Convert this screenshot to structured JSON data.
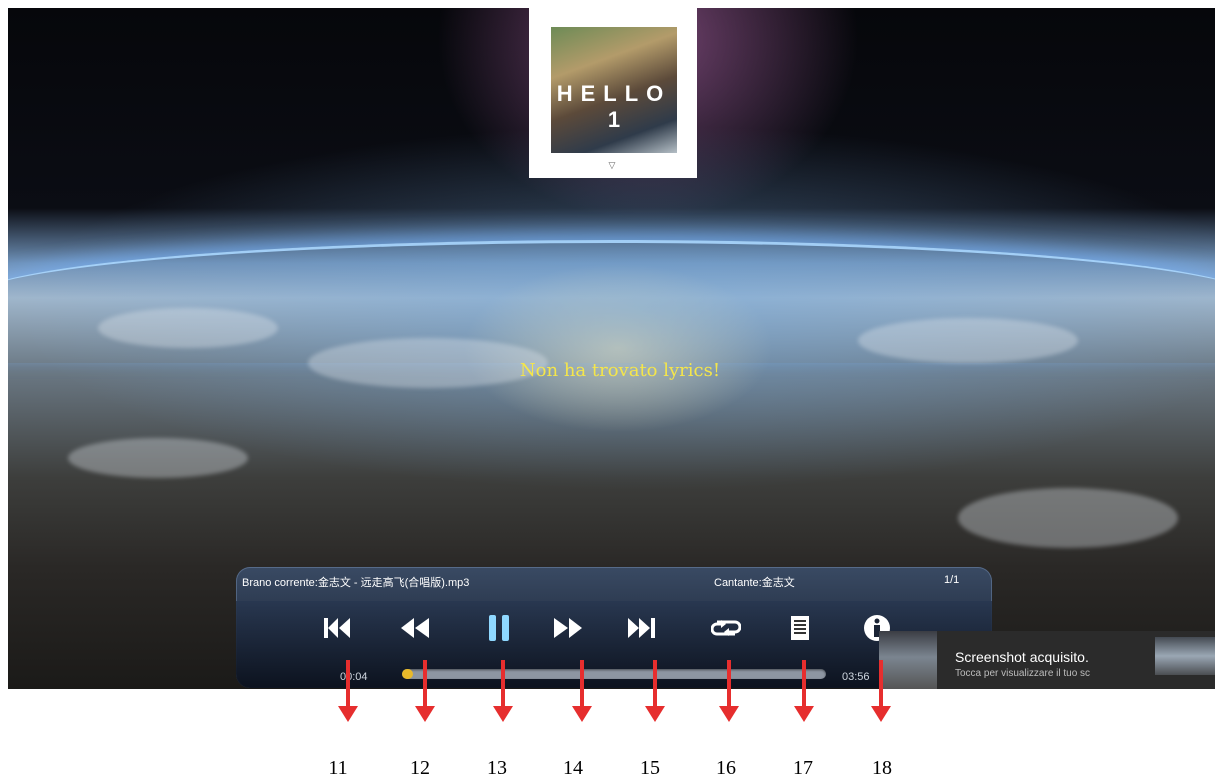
{
  "album": {
    "title": "HELLO",
    "number": "1",
    "logo": "▽"
  },
  "lyrics_message": "Non ha trovato lyrics!",
  "player": {
    "current_track": "Brano corrente:金志文 - 远走高飞(合唱版).mp3",
    "artist": "Cantante:金志文",
    "track_count": "1/1",
    "elapsed": "00:04",
    "duration": "03:56",
    "progress_fraction": 0.02,
    "controls": [
      {
        "name": "previous-track",
        "icon": "skip-previous-icon"
      },
      {
        "name": "rewind",
        "icon": "rewind-icon"
      },
      {
        "name": "pause",
        "icon": "pause-icon"
      },
      {
        "name": "fast-forward",
        "icon": "fast-forward-icon"
      },
      {
        "name": "next-track",
        "icon": "skip-next-icon"
      },
      {
        "name": "repeat",
        "icon": "repeat-icon"
      },
      {
        "name": "playlist",
        "icon": "document-icon"
      },
      {
        "name": "info",
        "icon": "info-icon"
      }
    ]
  },
  "toast": {
    "title": "Screenshot acquisito.",
    "subtitle": "Tocca per visualizzare il tuo sc"
  },
  "callouts": [
    "11",
    "12",
    "13",
    "14",
    "15",
    "16",
    "17",
    "18"
  ],
  "colors": {
    "lyrics": "#f5e64a",
    "progress": "#e8b92a",
    "arrow": "#e62e2e",
    "pause_active": "#8fd8ff"
  }
}
